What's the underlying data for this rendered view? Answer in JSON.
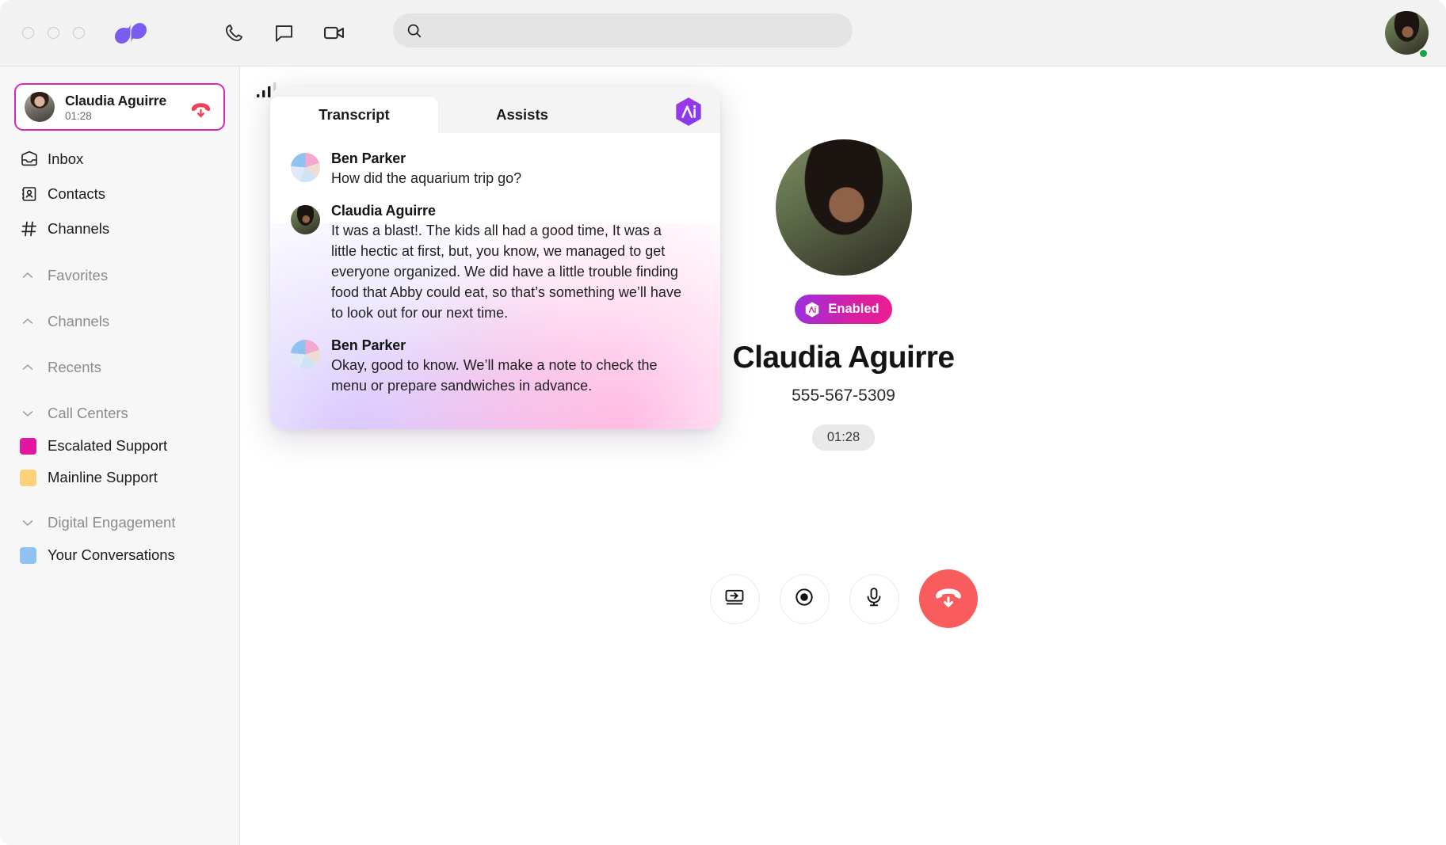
{
  "titlebar": {
    "window_controls": [
      "close",
      "minimize",
      "maximize"
    ],
    "logo_name": "dialpad-logo",
    "actions": [
      {
        "icon": "phone-icon",
        "name": "phone"
      },
      {
        "icon": "message-icon",
        "name": "messages"
      },
      {
        "icon": "video-camera-icon",
        "name": "video"
      }
    ],
    "search": {
      "value": "",
      "placeholder": ""
    },
    "me": {
      "avatar": "user-avatar",
      "status": "online"
    }
  },
  "sidebar": {
    "active_call": {
      "name": "Claudia Aguirre",
      "duration": "01:28",
      "hangup_label": "hang-up"
    },
    "nav": [
      {
        "label": "Inbox",
        "icon": "inbox-icon"
      },
      {
        "label": "Contacts",
        "icon": "contacts-icon"
      },
      {
        "label": "Channels",
        "icon": "hash-icon"
      }
    ],
    "sections": [
      {
        "label": "Favorites",
        "state": "collapsed",
        "chevron": "chevron-up-icon",
        "items": []
      },
      {
        "label": "Channels",
        "state": "collapsed",
        "chevron": "chevron-up-icon",
        "items": []
      },
      {
        "label": "Recents",
        "state": "collapsed",
        "chevron": "chevron-up-icon",
        "items": []
      },
      {
        "label": "Call Centers",
        "state": "expanded",
        "chevron": "chevron-down-icon",
        "items": [
          {
            "label": "Escalated Support",
            "color": "#e3169f"
          },
          {
            "label": "Mainline Support",
            "color": "#fcd177"
          }
        ]
      },
      {
        "label": "Digital Engagement",
        "state": "expanded",
        "chevron": "chevron-down-icon",
        "items": [
          {
            "label": "Your Conversations",
            "color": "#8fc2f2"
          }
        ]
      }
    ]
  },
  "call": {
    "signal_icon": "signal-strength-icon",
    "contact_photo": "contact-avatar",
    "ai_badge": {
      "label": "Enabled",
      "icon": "ai-hexagon-icon",
      "gradient_from": "#9b30e0",
      "gradient_to": "#ee1d8f"
    },
    "contact_name": "Claudia Aguirre",
    "phone": "555-567-5309",
    "duration": "01:28",
    "controls": [
      {
        "name": "transfer-call-button",
        "icon": "screen-transfer-icon"
      },
      {
        "name": "record-call-button",
        "icon": "record-circle-icon"
      },
      {
        "name": "mute-button",
        "icon": "microphone-icon"
      },
      {
        "name": "end-call-button",
        "icon": "hang-up-icon",
        "color": "#f85c5c"
      }
    ]
  },
  "transcript_panel": {
    "tabs": [
      {
        "label": "Transcript",
        "active": true
      },
      {
        "label": "Assists",
        "active": false
      }
    ],
    "ai_icon": "ai-hexagon-icon",
    "messages": [
      {
        "speaker": "Ben Parker",
        "avatar": "pie-avatar",
        "text": "How did the aquarium trip go?"
      },
      {
        "speaker": "Claudia Aguirre",
        "avatar": "contact-avatar",
        "text": "It was a blast!. The kids all had a good time, It was a little hectic at first, but, you know, we managed to get everyone organized. We did have a little trouble finding food that Abby could eat, so that’s something we’ll have to look out for our next time."
      },
      {
        "speaker": "Ben Parker",
        "avatar": "pie-avatar",
        "text": "Okay, good to know. We’ll make a note to check the menu or prepare sandwiches in advance."
      }
    ]
  }
}
